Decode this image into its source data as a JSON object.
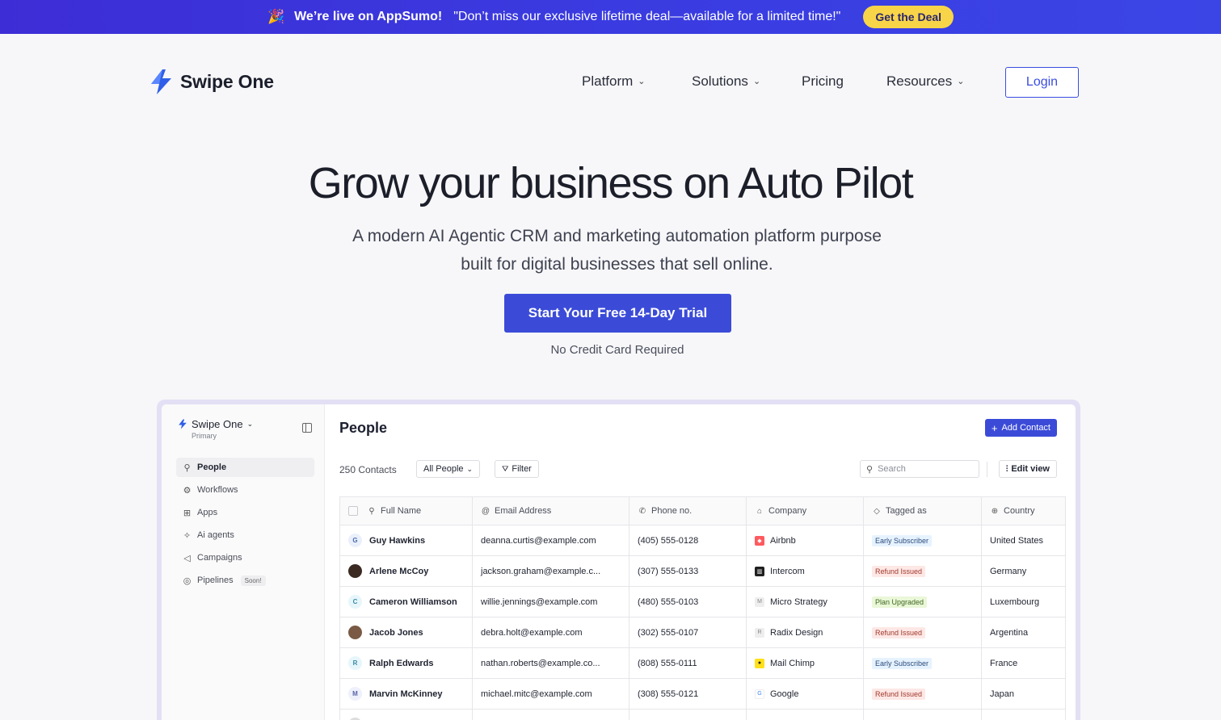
{
  "banner": {
    "icon": "party-popper-icon",
    "live": "We’re live on AppSumo!",
    "message": "\"Don’t miss our exclusive lifetime deal—available for a limited time!\"",
    "cta": "Get the Deal"
  },
  "brand": {
    "name": "Swipe One",
    "color": "#2f5fe8"
  },
  "nav": {
    "items": [
      {
        "label": "Platform",
        "dropdown": true
      },
      {
        "label": "Solutions",
        "dropdown": true
      },
      {
        "label": "Pricing",
        "dropdown": false
      },
      {
        "label": "Resources",
        "dropdown": true
      }
    ],
    "login": "Login"
  },
  "hero": {
    "title": "Grow your business on Auto Pilot",
    "subtitle_line1": "A modern AI Agentic CRM and marketing automation platform purpose",
    "subtitle_line2": "built for digital businesses that sell online.",
    "cta": "Start Your Free 14-Day Trial",
    "note": "No Credit Card Required"
  },
  "app": {
    "workspace": {
      "name": "Swipe One",
      "sub": "Primary"
    },
    "sidebar": [
      {
        "label": "People",
        "icon": "person-icon",
        "active": true
      },
      {
        "label": "Workflows",
        "icon": "workflow-icon"
      },
      {
        "label": "Apps",
        "icon": "apps-grid-icon"
      },
      {
        "label": "Ai agents",
        "icon": "sparkle-icon"
      },
      {
        "label": "Campaigns",
        "icon": "megaphone-icon"
      },
      {
        "label": "Pipelines",
        "icon": "target-icon",
        "badge": "Soon!"
      }
    ],
    "page_title": "People",
    "add_contact": "Add Contact",
    "count": "250 Contacts",
    "view": "All People",
    "filter": "Filter",
    "search_placeholder": "Search",
    "edit_view": "Edit view",
    "columns": [
      "Full Name",
      "Email Address",
      "Phone no.",
      "Company",
      "Tagged as",
      "Country"
    ],
    "rows": [
      {
        "initial": "G",
        "name": "Guy Hawkins",
        "email": "deanna.curtis@example.com",
        "phone": "(405) 555-0128",
        "company": "Airbnb",
        "tag": "Early Subscriber",
        "tag_color": "blue",
        "country": "United States"
      },
      {
        "initial": "",
        "name": "Arlene McCoy",
        "email": "jackson.graham@example.c...",
        "phone": "(307) 555-0133",
        "company": "Intercom",
        "tag": "Refund Issued",
        "tag_color": "red",
        "country": "Germany"
      },
      {
        "initial": "C",
        "name": "Cameron Williamson",
        "email": "willie.jennings@example.com",
        "phone": "(480) 555-0103",
        "company": "Micro Strategy",
        "tag": "Plan Upgraded",
        "tag_color": "green",
        "country": "Luxembourg"
      },
      {
        "initial": "",
        "name": "Jacob Jones",
        "email": "debra.holt@example.com",
        "phone": "(302) 555-0107",
        "company": "Radix Design",
        "tag": "Refund Issued",
        "tag_color": "red",
        "country": "Argentina"
      },
      {
        "initial": "R",
        "name": "Ralph Edwards",
        "email": "nathan.roberts@example.co...",
        "phone": "(808) 555-0111",
        "company": "Mail Chimp",
        "tag": "Early Subscriber",
        "tag_color": "blue",
        "country": "France"
      },
      {
        "initial": "M",
        "name": "Marvin McKinney",
        "email": "michael.mitc@example.com",
        "phone": "(308) 555-0121",
        "company": "Google",
        "tag": "Refund Issued",
        "tag_color": "red",
        "country": "Japan"
      }
    ]
  }
}
